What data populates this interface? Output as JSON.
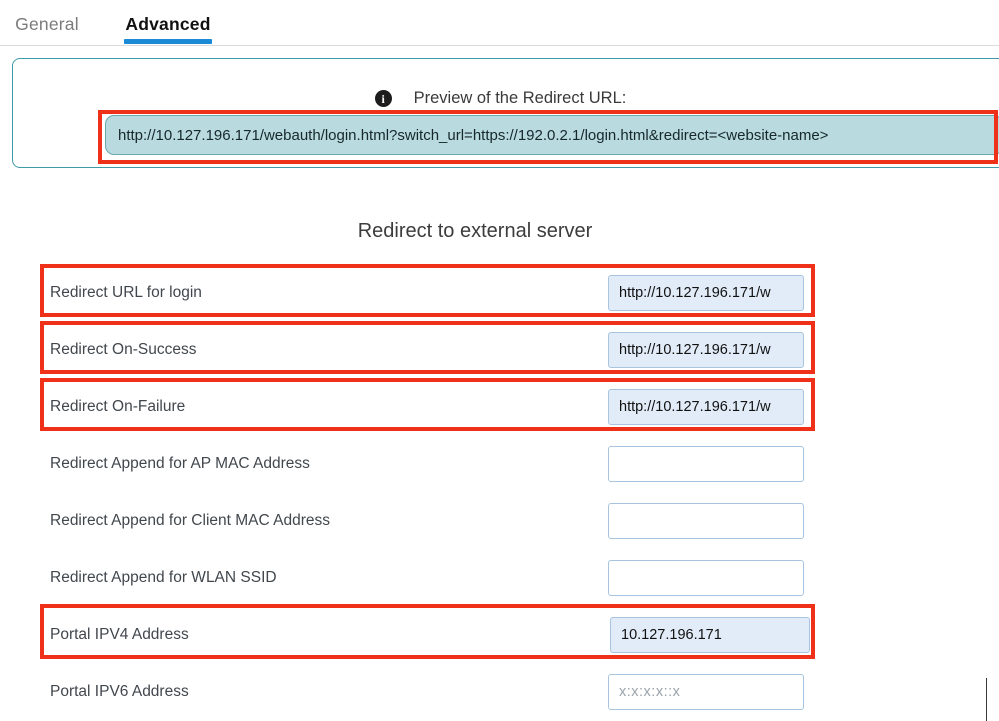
{
  "tabs": [
    {
      "label": "General",
      "active": false
    },
    {
      "label": "Advanced",
      "active": true
    }
  ],
  "preview": {
    "info_icon": "info-icon",
    "title": "Preview of the Redirect URL:",
    "url": "http://10.127.196.171/webauth/login.html?switch_url=https://192.0.2.1/login.html&redirect=<website-name>"
  },
  "section": {
    "title": "Redirect to external server"
  },
  "fields": [
    {
      "label": "Redirect URL for login",
      "value": "http://10.127.196.171/w",
      "placeholder": "",
      "filled": true,
      "highlighted": true
    },
    {
      "label": "Redirect On-Success",
      "value": "http://10.127.196.171/w",
      "placeholder": "",
      "filled": true,
      "highlighted": true
    },
    {
      "label": "Redirect On-Failure",
      "value": "http://10.127.196.171/w",
      "placeholder": "",
      "filled": true,
      "highlighted": true
    },
    {
      "label": "Redirect Append for AP MAC Address",
      "value": "",
      "placeholder": "",
      "filled": false,
      "highlighted": false
    },
    {
      "label": "Redirect Append for Client MAC Address",
      "value": "",
      "placeholder": "",
      "filled": false,
      "highlighted": false
    },
    {
      "label": "Redirect Append for WLAN SSID",
      "value": "",
      "placeholder": "",
      "filled": false,
      "highlighted": false
    },
    {
      "label": "Portal IPV4 Address",
      "value": "10.127.196.171",
      "placeholder": "",
      "filled": true,
      "highlighted": true
    },
    {
      "label": "Portal IPV6 Address",
      "value": "",
      "placeholder": "x:x:x:x::x",
      "filled": false,
      "highlighted": false
    }
  ],
  "colors": {
    "accent_tab": "#1b8ad6",
    "panel_border": "#3e9aa4",
    "url_box_bg": "#b9dade",
    "highlight": "#f0311a",
    "field_filled_bg": "#e2ecf8",
    "field_border": "#a8c4de"
  }
}
